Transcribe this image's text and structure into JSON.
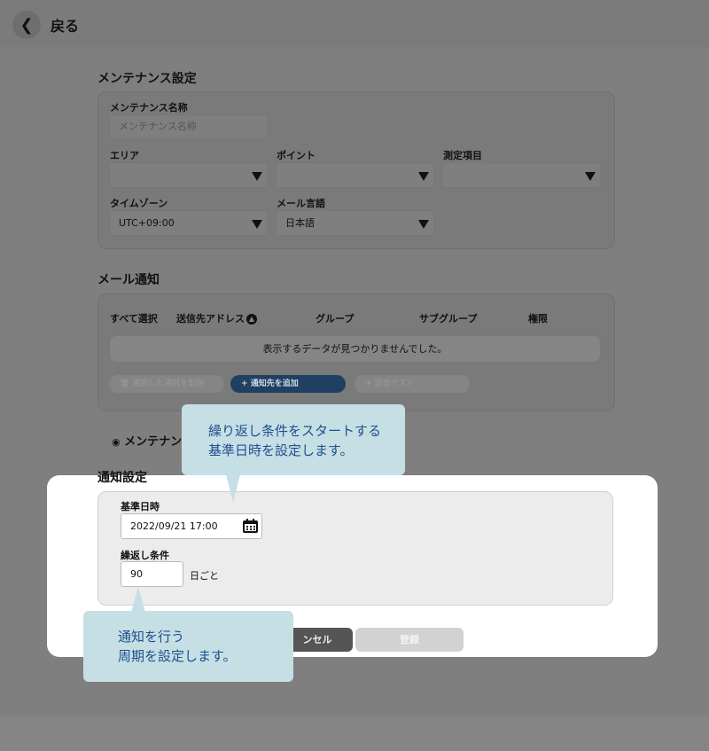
{
  "header": {
    "back_label": "戻る"
  },
  "maintenance": {
    "title": "メンテナンス設定",
    "name_label": "メンテナンス名称",
    "name_placeholder": "メンテナンス名称",
    "area_label": "エリア",
    "point_label": "ポイント",
    "measure_label": "測定項目",
    "timezone_label": "タイムゾーン",
    "timezone_value": "UTC+09:00",
    "mail_lang_label": "メール言語",
    "mail_lang_value": "日本語"
  },
  "mail": {
    "title": "メール通知",
    "columns": [
      "すべて選択",
      "送信先アドレス",
      "グループ",
      "サブグループ",
      "権限"
    ],
    "empty_message": "表示するデータが見つかりませんでした。",
    "delete_label": "選択した項目を削除",
    "add_label": "通知先を追加",
    "test_label": "送信テスト"
  },
  "radio_partial": "メンテナン",
  "notice": {
    "title": "通知設定",
    "base_date_label": "基準日時",
    "base_date_value": "2022/09/21 17:00",
    "repeat_label": "繰返し条件",
    "repeat_value": "90",
    "repeat_unit": "日ごと"
  },
  "buttons": {
    "cancel_partial": "ンセル",
    "register": "登録"
  },
  "callouts": {
    "top_line1": "繰り返し条件をスタートする",
    "top_line2": "基準日時を設定します。",
    "bottom_line1": "通知を行う",
    "bottom_line2": "周期を設定します。"
  },
  "colors": {
    "accent": "#1f3f63",
    "callout_bg": "#c5dfe5",
    "callout_text": "#1f4f8c"
  },
  "icons": [
    "chevron-left-icon",
    "chevron-down-icon",
    "calendar-icon",
    "trash-icon",
    "plus-icon",
    "send-icon",
    "sort-up-icon",
    "radio-icon"
  ]
}
